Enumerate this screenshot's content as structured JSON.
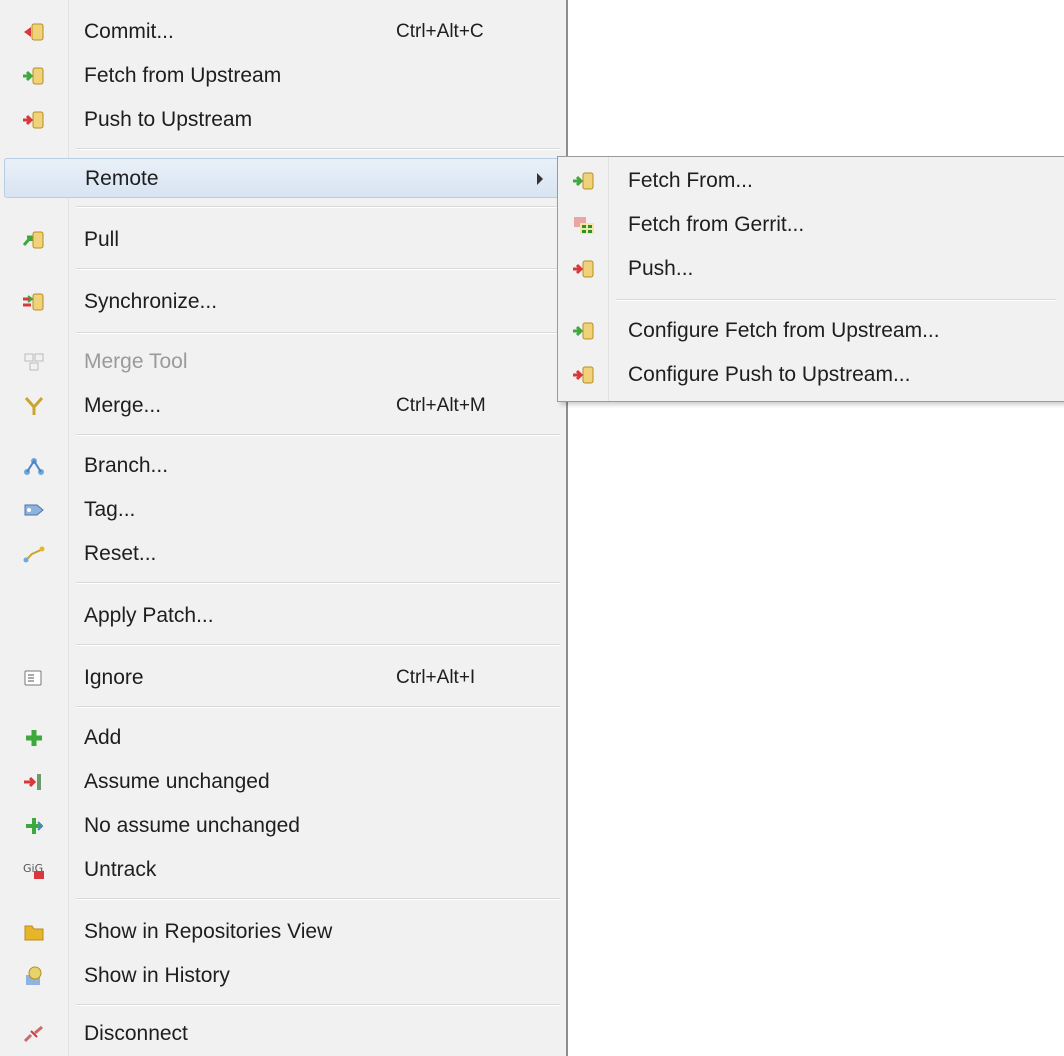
{
  "menu": {
    "commit": {
      "label": "Commit...",
      "shortcut": "Ctrl+Alt+C",
      "icon": "commit-icon"
    },
    "fetch_upstream": {
      "label": "Fetch from Upstream",
      "icon": "fetch-icon"
    },
    "push_upstream": {
      "label": "Push to Upstream",
      "icon": "push-icon"
    },
    "remote": {
      "label": "Remote"
    },
    "pull": {
      "label": "Pull",
      "icon": "pull-icon"
    },
    "synchronize": {
      "label": "Synchronize...",
      "icon": "synchronize-icon"
    },
    "merge_tool": {
      "label": "Merge Tool",
      "icon": "merge-tool-icon",
      "disabled": true
    },
    "merge": {
      "label": "Merge...",
      "shortcut": "Ctrl+Alt+M",
      "icon": "merge-icon"
    },
    "branch": {
      "label": "Branch...",
      "icon": "branch-icon"
    },
    "tag": {
      "label": "Tag...",
      "icon": "tag-icon"
    },
    "reset": {
      "label": "Reset...",
      "icon": "reset-icon"
    },
    "apply_patch": {
      "label": "Apply Patch..."
    },
    "ignore": {
      "label": "Ignore",
      "shortcut": "Ctrl+Alt+I",
      "icon": "ignore-icon"
    },
    "add": {
      "label": "Add",
      "icon": "add-icon"
    },
    "assume_unchanged": {
      "label": "Assume unchanged",
      "icon": "assume-unchanged-icon"
    },
    "no_assume_unchanged": {
      "label": "No assume unchanged",
      "icon": "no-assume-unchanged-icon"
    },
    "untrack": {
      "label": "Untrack",
      "icon": "untrack-icon"
    },
    "show_repositories": {
      "label": "Show in Repositories View",
      "icon": "repositories-icon"
    },
    "show_history": {
      "label": "Show in History",
      "icon": "history-icon"
    },
    "disconnect": {
      "label": "Disconnect",
      "icon": "disconnect-icon"
    }
  },
  "submenu": {
    "fetch_from": {
      "label": "Fetch From...",
      "icon": "fetch-icon"
    },
    "fetch_gerrit": {
      "label": "Fetch from Gerrit...",
      "icon": "gerrit-icon"
    },
    "push": {
      "label": "Push...",
      "icon": "push-icon"
    },
    "configure_fetch": {
      "label": "Configure Fetch from Upstream...",
      "icon": "fetch-icon"
    },
    "configure_push": {
      "label": "Configure Push to Upstream...",
      "icon": "push-icon"
    }
  },
  "colors": {
    "menu_bg": "#f1f1f1",
    "highlight": "#d8e4f2",
    "disabled_text": "#9a9a9a",
    "fetch_green": "#3da83d",
    "push_red": "#d9383a",
    "repo_yellow": "#e7b52a"
  }
}
